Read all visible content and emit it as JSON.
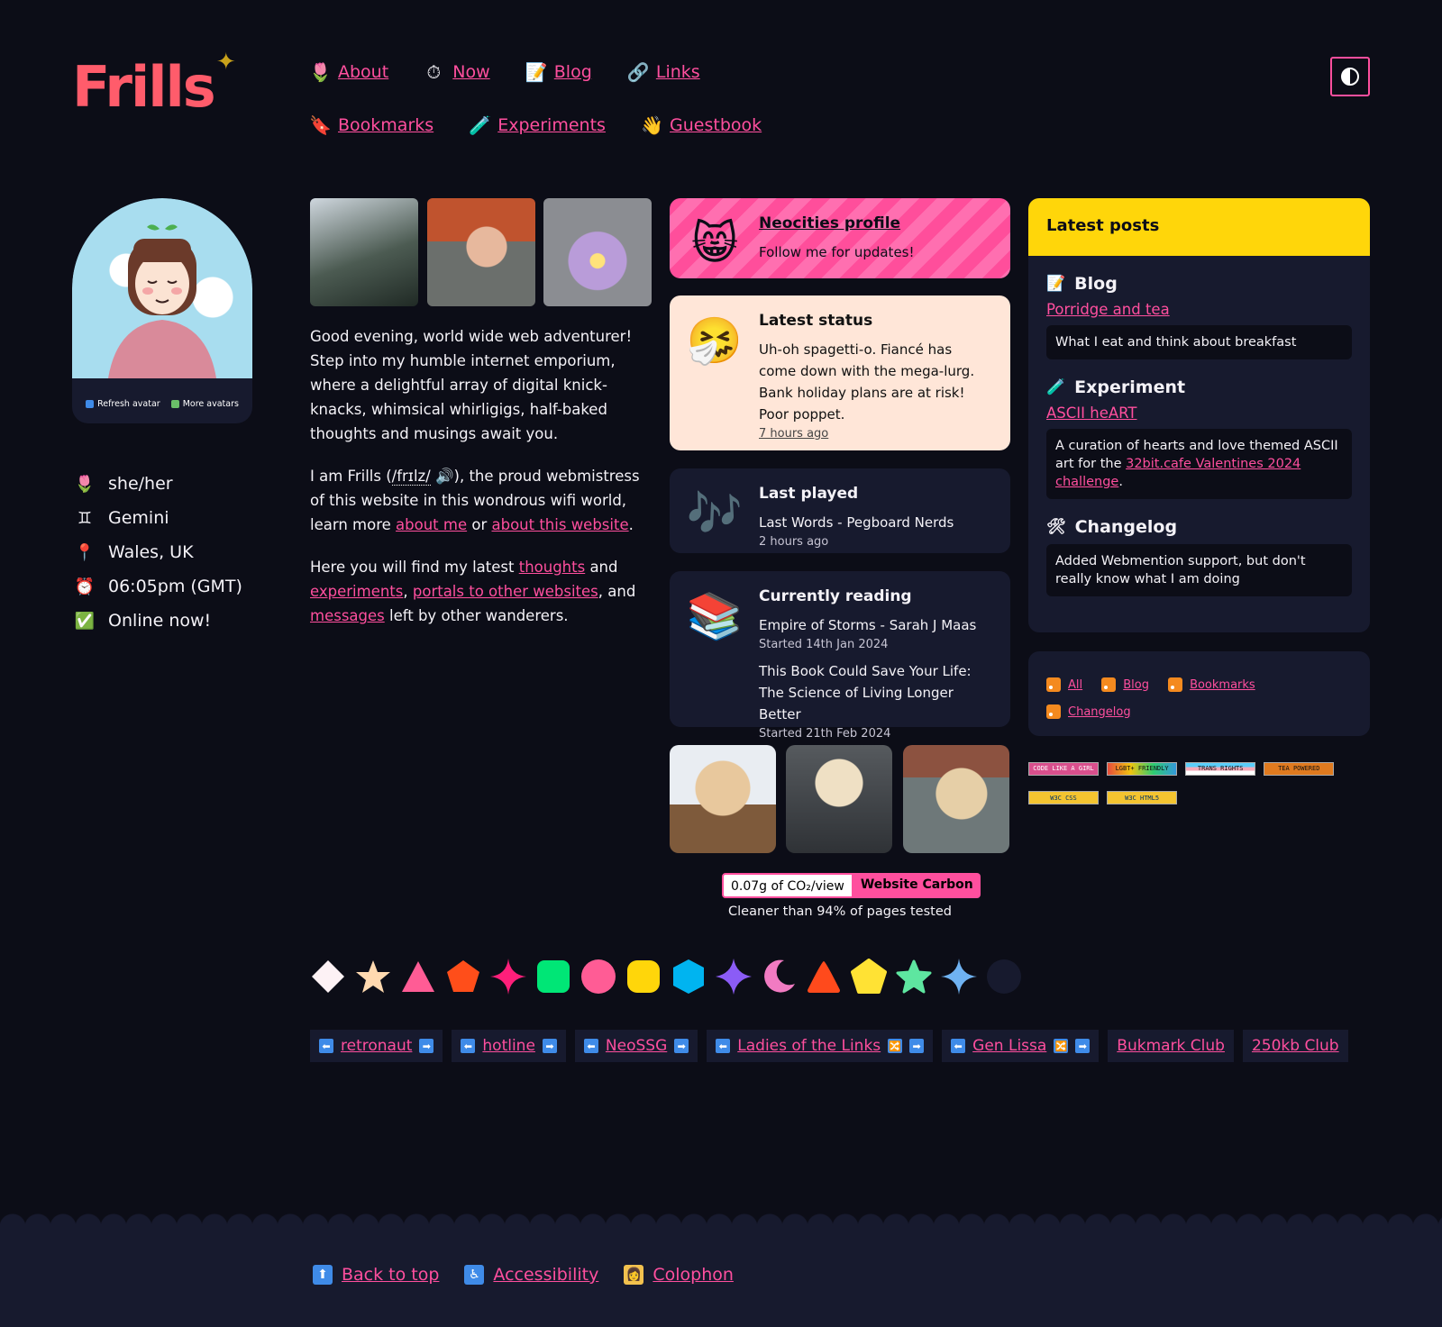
{
  "header": {
    "logo": "Frills",
    "theme_toggle_icon": "contrast-icon",
    "nav": [
      {
        "label": "About",
        "icon": "tulip-icon",
        "glyph": "🌷"
      },
      {
        "label": "Now",
        "icon": "stopwatch-icon",
        "glyph": "⏱"
      },
      {
        "label": "Blog",
        "icon": "memo-icon",
        "glyph": "📝"
      },
      {
        "label": "Links",
        "icon": "link-icon",
        "glyph": "🔗"
      },
      {
        "label": "Bookmarks",
        "icon": "bookmark-icon",
        "glyph": "🔖"
      },
      {
        "label": "Experiments",
        "icon": "test-tube-icon",
        "glyph": "🧪"
      },
      {
        "label": "Guestbook",
        "icon": "waving-hand-icon",
        "glyph": "👋"
      }
    ]
  },
  "avatar": {
    "refresh_label": "Refresh avatar",
    "more_label": "More avatars"
  },
  "profile": [
    {
      "text": "she/her",
      "icon": "tulip-icon",
      "glyph": "🌷"
    },
    {
      "text": "Gemini",
      "icon": "gemini-icon",
      "glyph": "♊"
    },
    {
      "text": "Wales, UK",
      "icon": "pin-icon",
      "glyph": "📍"
    },
    {
      "text": "06:05pm (GMT)",
      "icon": "alarm-clock-icon",
      "glyph": "⏰"
    },
    {
      "text": "Online now!",
      "icon": "check-icon",
      "glyph": "✅"
    }
  ],
  "intro": {
    "p1": "Good evening, world wide web adventurer! Step into my humble internet emporium, where a delightful array of digital knick-knacks, whimsical whirligigs, half-baked thoughts and musings await you.",
    "p2_a": "I am Frills (",
    "p2_phonetic": "/frɪlz/",
    "p2_b": " 🔊), the proud webmistress of this website in this wondrous wifi world, learn more ",
    "p2_link1": "about me",
    "p2_c": " or ",
    "p2_link2": "about this website",
    "p2_d": ".",
    "p3_a": "Here you will find my latest ",
    "p3_link1": "thoughts",
    "p3_b": " and ",
    "p3_link2": "experiments",
    "p3_c": ", ",
    "p3_link3": "portals to other websites",
    "p3_d": ", and ",
    "p3_link4": "messages",
    "p3_e": " left by other wanderers."
  },
  "neocities": {
    "title": "Neocities profile",
    "text": "Follow me for updates!",
    "icon": "cat-icon",
    "glyph": "😸"
  },
  "status": {
    "title": "Latest status",
    "text": "Uh-oh spagetti-o. Fiancé has come down with the mega-lurg. Bank holiday plans are at risk! Poor poppet.",
    "time": "7 hours ago",
    "icon": "sneezing-face-icon",
    "glyph": "🤧"
  },
  "played": {
    "title": "Last played",
    "track": "Last Words - Pegboard Nerds",
    "time": "2 hours ago",
    "icon": "music-notes-icon",
    "glyph": "🎶"
  },
  "reading": {
    "title": "Currently reading",
    "icon": "books-icon",
    "glyph": "📚",
    "books": [
      {
        "title": "Empire of Storms - Sarah J Maas",
        "started": "Started 14th Jan 2024"
      },
      {
        "title": "This Book Could Save Your Life: The Science of Living Longer Better",
        "started": "Started 21th Feb 2024"
      }
    ]
  },
  "carbon": {
    "value": "0.07g of CO₂/view",
    "label": "Website Carbon",
    "note": "Cleaner than 94% of pages tested"
  },
  "latest": {
    "title": "Latest posts",
    "posts": [
      {
        "category": "Blog",
        "icon": "memo-icon",
        "glyph": "📝",
        "link": "Porridge and tea",
        "summary": "What I eat and think about breakfast"
      },
      {
        "category": "Experiment",
        "icon": "test-tube-icon",
        "glyph": "🧪",
        "link": "ASCII heART",
        "summary_a": "A curation of hearts and love themed ASCII art for the ",
        "summary_link": "32bit.cafe Valentines 2024 challenge",
        "summary_b": "."
      },
      {
        "category": "Changelog",
        "icon": "tools-icon",
        "glyph": "🛠",
        "summary": "Added Webmention support, but don't really know what I am doing"
      }
    ]
  },
  "feeds": [
    "All",
    "Blog",
    "Bookmarks",
    "Changelog"
  ],
  "badges": [
    "CODE LIKE A GIRL",
    "LGBT+ FRIENDLY",
    "TRANS RIGHTS",
    "TEA POWERED",
    "W3C CSS",
    "W3C HTML5"
  ],
  "shape_colors": [
    "#fdf2f5",
    "#ffd9b0",
    "#ff5c95",
    "#ff4e1a",
    "#ff1f7a",
    "#00e676",
    "#ff5c95",
    "#ffd60a",
    "#00b4f0",
    "#8b5cf6",
    "#f17bc2",
    "#ff4a1c",
    "#ffe234",
    "#5ee6a0",
    "#6fb2f2",
    "#171a2e"
  ],
  "webrings": [
    {
      "label": "retronaut",
      "left": "⬅",
      "right": "➡"
    },
    {
      "label": "hotline",
      "left": "⬅",
      "right": "➡"
    },
    {
      "label": "NeoSSG",
      "left": "⬅",
      "right": "➡"
    },
    {
      "label": "Ladies of the Links",
      "left": "⬅",
      "mid": "🔀",
      "right": "➡"
    },
    {
      "label": "Gen Lissa",
      "left": "⬅",
      "mid": "🔀",
      "right": "➡"
    },
    {
      "label": "Bukmark Club"
    },
    {
      "label": "250kb Club"
    }
  ],
  "footer": [
    {
      "label": "Back to top",
      "icon": "arrow-up-icon",
      "glyph": "⬆"
    },
    {
      "label": "Accessibility",
      "icon": "wheelchair-icon",
      "glyph": "♿"
    },
    {
      "label": "Colophon",
      "icon": "technologist-icon",
      "glyph": "👩"
    }
  ],
  "accent": "#ff4f9e"
}
